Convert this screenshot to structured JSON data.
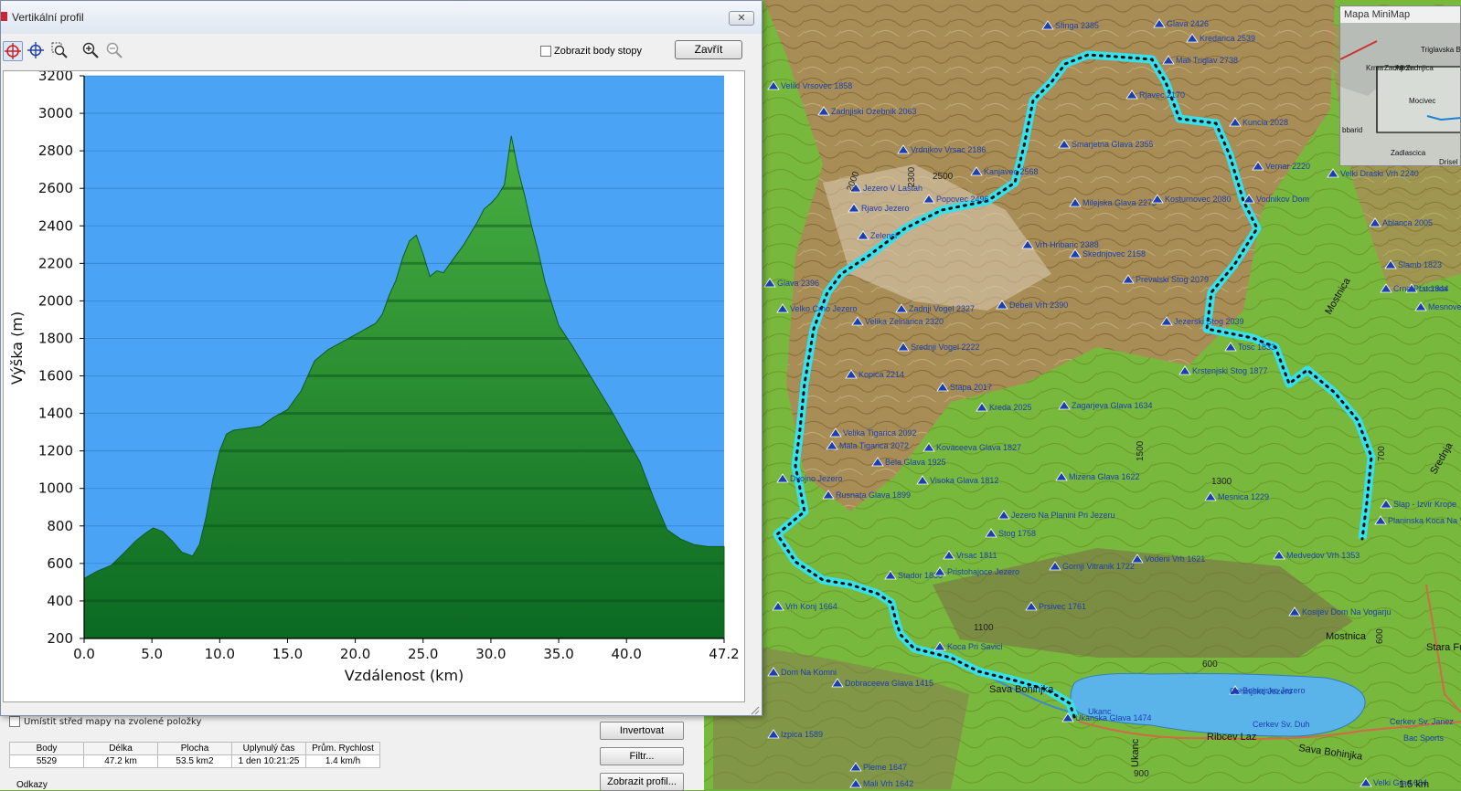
{
  "window": {
    "title": "Vertikální profil",
    "close_symbol": "✕"
  },
  "toolbar": {
    "show_track_points_label": "Zobrazit body stopy",
    "close_button_label": "Zavřít",
    "tools": [
      "track-select-icon",
      "crosshair-icon",
      "zoom-area-icon",
      "zoom-in-icon",
      "zoom-out-icon"
    ]
  },
  "chart_data": {
    "type": "area",
    "title": "",
    "xlabel": "Vzdálenost   (km)",
    "ylabel": "Výška  (m)",
    "xlim": [
      0,
      47.2
    ],
    "ylim": [
      200,
      3200
    ],
    "x_ticks": [
      "0.0",
      "5.0",
      "10.0",
      "15.0",
      "20.0",
      "25.0",
      "30.0",
      "35.0",
      "40.0",
      "47.2"
    ],
    "y_ticks": [
      "200",
      "400",
      "600",
      "800",
      "1000",
      "1200",
      "1400",
      "1600",
      "1800",
      "2000",
      "2200",
      "2400",
      "2600",
      "2800",
      "3000",
      "3200"
    ],
    "grid": true,
    "colors": {
      "background": "#4aa3f5",
      "fill_top": "#49b041",
      "fill_bottom": "#0b6a22"
    },
    "x": [
      0,
      1,
      2,
      3,
      3.8,
      4.5,
      5.1,
      5.8,
      6.5,
      7.2,
      8.0,
      8.5,
      9.0,
      9.5,
      10.0,
      10.5,
      11.0,
      12.0,
      13.0,
      14.0,
      15.0,
      15.5,
      16.0,
      17.0,
      18.0,
      19.0,
      20.0,
      21.0,
      21.5,
      22.0,
      22.5,
      23.0,
      23.5,
      24.0,
      24.5,
      25.0,
      25.5,
      26.0,
      26.5,
      27.0,
      28.0,
      29.0,
      29.5,
      30.0,
      30.5,
      31.0,
      31.5,
      32.0,
      32.5,
      33.0,
      33.5,
      34.0,
      35.0,
      36.0,
      37.0,
      38.0,
      39.0,
      40.0,
      41.0,
      42.0,
      43.0,
      44.0,
      45.0,
      46.0,
      47.2
    ],
    "y": [
      520,
      560,
      590,
      660,
      720,
      760,
      790,
      770,
      720,
      660,
      640,
      700,
      850,
      1050,
      1200,
      1290,
      1310,
      1320,
      1330,
      1380,
      1420,
      1470,
      1520,
      1680,
      1740,
      1780,
      1820,
      1860,
      1880,
      1930,
      2030,
      2110,
      2230,
      2320,
      2350,
      2250,
      2130,
      2160,
      2150,
      2200,
      2300,
      2420,
      2490,
      2520,
      2560,
      2620,
      2880,
      2700,
      2560,
      2400,
      2260,
      2100,
      1870,
      1760,
      1640,
      1520,
      1400,
      1270,
      1140,
      950,
      780,
      730,
      700,
      690,
      690
    ]
  },
  "lower_panel": {
    "center_map_label": "Umístit střed mapy na zvolené položky",
    "stats_headers": [
      "Body",
      "Délka",
      "Plocha",
      "Uplynulý čas",
      "Prům. Rychlost"
    ],
    "stats_values": [
      "5529",
      "47.2 km",
      "53.5 km2",
      "1 den 10:21:25",
      "1.4 km/h"
    ],
    "invert_button": "Invertovat",
    "filter_button": "Filtr...",
    "show_profile_button": "Zobrazit profil...",
    "links_label": "Odkazy"
  },
  "minimap": {
    "title": "Mapa MiniMap",
    "labels": [
      "Triglavska Bistr",
      "Krma",
      "Zadnjica",
      "Alt Zadnjica",
      "Mocivec",
      "bbarid",
      "Zadlascica",
      "Drisel"
    ]
  },
  "map": {
    "peaks": [
      "Sfinga 2385",
      "Glava 2426",
      "Kredarica 2539",
      "Mali Triglav 2738",
      "Veliki Vrsovec 1858",
      "Zadnjiski Ozebnik 2063",
      "Rjavec 2170",
      "Kuncia 2028",
      "Vrdnikov Vrsac 2186",
      "Smarjetna Glava 2355",
      "Vernar 2220",
      "Velki Draski Vrh 2240",
      "Kanjavec 2568",
      "Popovec 2496",
      "Milejska Glava 2273",
      "Kosturnovec 2080",
      "Vodnikov Dom",
      "Ablanca 2005",
      "Vrh Hribaric 2388",
      "Skednjovec 2158",
      "Prevalski Stog 2079",
      "Debeli Vrh 2390",
      "Jezerski Stog 2039",
      "Zadnji Vogel 2327",
      "Velika Zelnarica 2320",
      "Srednji Vogel 2222",
      "Tosc 1833",
      "Krstenjski Stog 1877",
      "Kopica 2214",
      "Stapa 2017",
      "Kreda 2025",
      "Zagarjeva Glava 1634",
      "Velika Tigarica 2092",
      "Mala Tigarica 2072",
      "Bela Glava 1925",
      "Kovaceeva Glava 1827",
      "Rusnata Glava 1899",
      "Visoka Glava 1812",
      "Mizena Glava 1622",
      "Mesnica 1229",
      "Slap - Izvir Krope",
      "Planinska Koca Na Vojah",
      "Jezero Na Planini Pri Jezeru",
      "Stog 1758",
      "Vrsac 1811",
      "Gornji Vitranik 1722",
      "Vodeni Vrh 1621",
      "Medvedov Vrh 1353",
      "Stador 1888",
      "Pristohajoce Jezero",
      "Vrh Konj 1664",
      "Prsivec 1761",
      "Koca Pri Savici",
      "Dom Na Komni",
      "Dobraceeva Glava 1415",
      "Kosijev Dom Na Vogarju",
      "Bohinjsko Jezero",
      "Ukanska Glava 1474",
      "Izpica 1589",
      "Pleme 1647",
      "Mali Vrh 1642",
      "Velki Grad 684",
      "Slamb 1823",
      "Mesnovec",
      "Lucnica",
      "Crna Prst 1844",
      "Jezero V Lastah",
      "Rjavo Jezero",
      "Zelenci",
      "Dvojno Jezero",
      "Velko Crno Jezero",
      "Glava 2396"
    ],
    "altitudes": [
      "2000",
      "2300",
      "2500",
      "1500",
      "1300",
      "1100",
      "600",
      "900",
      "700",
      "600"
    ],
    "places": [
      "Mostnica",
      "Sava Bohinjka",
      "Ribcev Laz",
      "Ukanc",
      "Stara Fuzina",
      "Mostnica",
      "Srednja",
      "Bohinjsko Jezero",
      "Sava Bohinjka",
      "Cerkev Sv. Duh",
      "Cerkev Sv. Janez",
      "Bac Sports",
      "Ukanc"
    ],
    "scale_label": "1.5 km"
  }
}
